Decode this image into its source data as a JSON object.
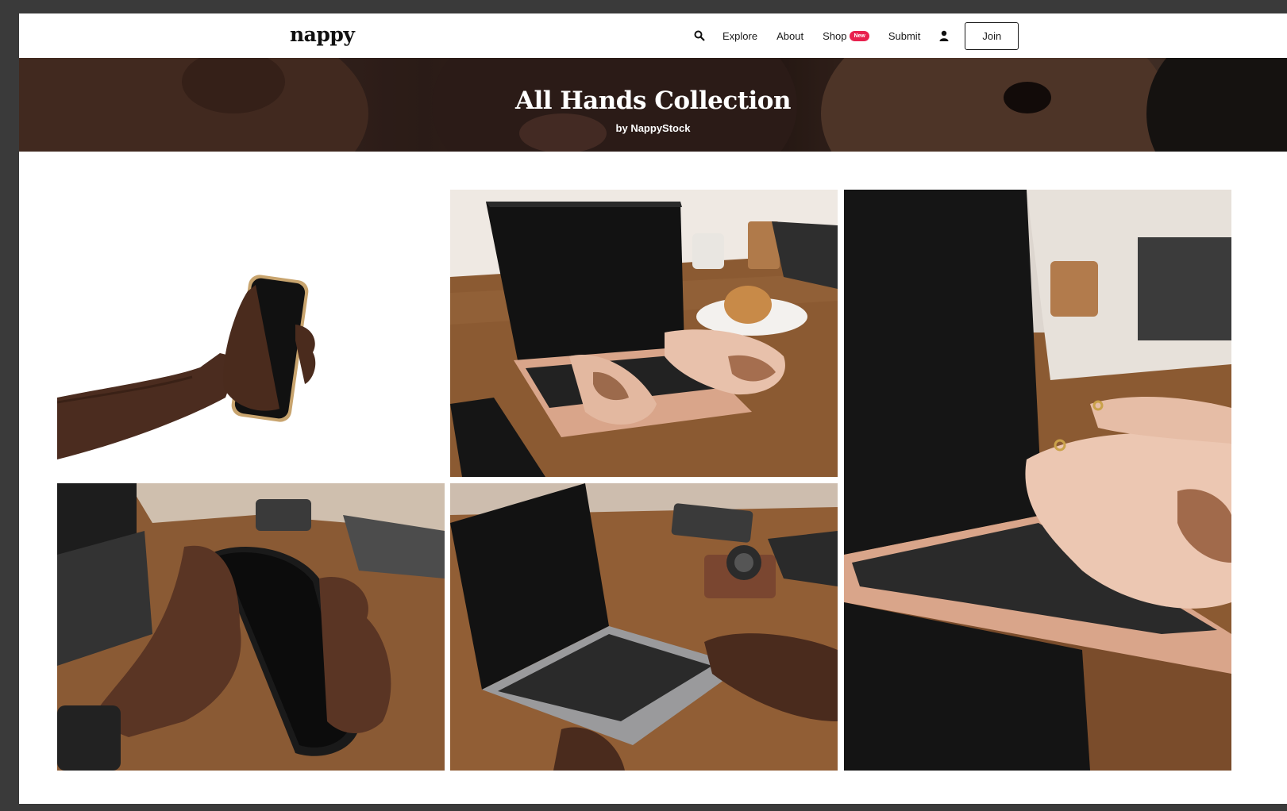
{
  "nav": {
    "logo": "nappy",
    "links": {
      "explore": "Explore",
      "about": "About",
      "shop": "Shop",
      "submit": "Submit"
    },
    "shop_badge": "New",
    "join_label": "Join",
    "icons": {
      "search": "search-icon",
      "user": "user-icon"
    }
  },
  "hero": {
    "title": "All Hands Collection",
    "subtitle": "by NappyStock"
  },
  "colors": {
    "badge": "#e8214e",
    "wood": "#8b5a32",
    "laptop_rose": "#d9a58a"
  },
  "photos": [
    {
      "name": "photo-hand-holding-phone"
    },
    {
      "name": "photo-typing-rose-laptop"
    },
    {
      "name": "photo-closeup-typing-laptop"
    },
    {
      "name": "photo-hands-holding-phone-desk"
    },
    {
      "name": "photo-hand-on-silver-laptop"
    }
  ]
}
